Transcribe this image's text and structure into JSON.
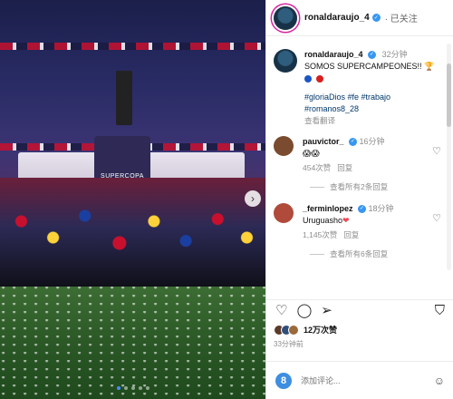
{
  "post": {
    "username": "ronaldaraujo_4",
    "follow_status": "· 已关注",
    "caption_time": "32分钟",
    "caption_text": "SOMOS SUPERCAMPEONES!! 🏆",
    "hashtags": "#gloriaDios #fe #trabajo #romanos8_28",
    "translate_label": "查看翻译",
    "photo_board_text": "SUPERCOPA"
  },
  "comments": [
    {
      "username": "pauvictor_",
      "time": "16分钟",
      "text": "😱😱",
      "likes": "454次赞",
      "reply_label": "回复",
      "view_replies": "查看所有2条回复",
      "avatar_color": "#7a4b2f"
    },
    {
      "username": "_ferminlopez",
      "time": "18分钟",
      "text": "Uruguasho",
      "likes": "1,145次赞",
      "reply_label": "回复",
      "view_replies": "查看所有6条回复",
      "avatar_color": "#b04a3a"
    }
  ],
  "actions": {
    "like_icon": "heart-outline-icon",
    "comment_icon": "comment-icon",
    "share_icon": "send-icon",
    "save_icon": "bookmark-icon"
  },
  "likes_count": "12万次赞",
  "posted_ago": "33分钟前",
  "composer": {
    "placeholder": "添加评论..."
  },
  "colors": {
    "verified": "#3897f0",
    "link": "#00376b",
    "muted": "#8e8e8e"
  }
}
